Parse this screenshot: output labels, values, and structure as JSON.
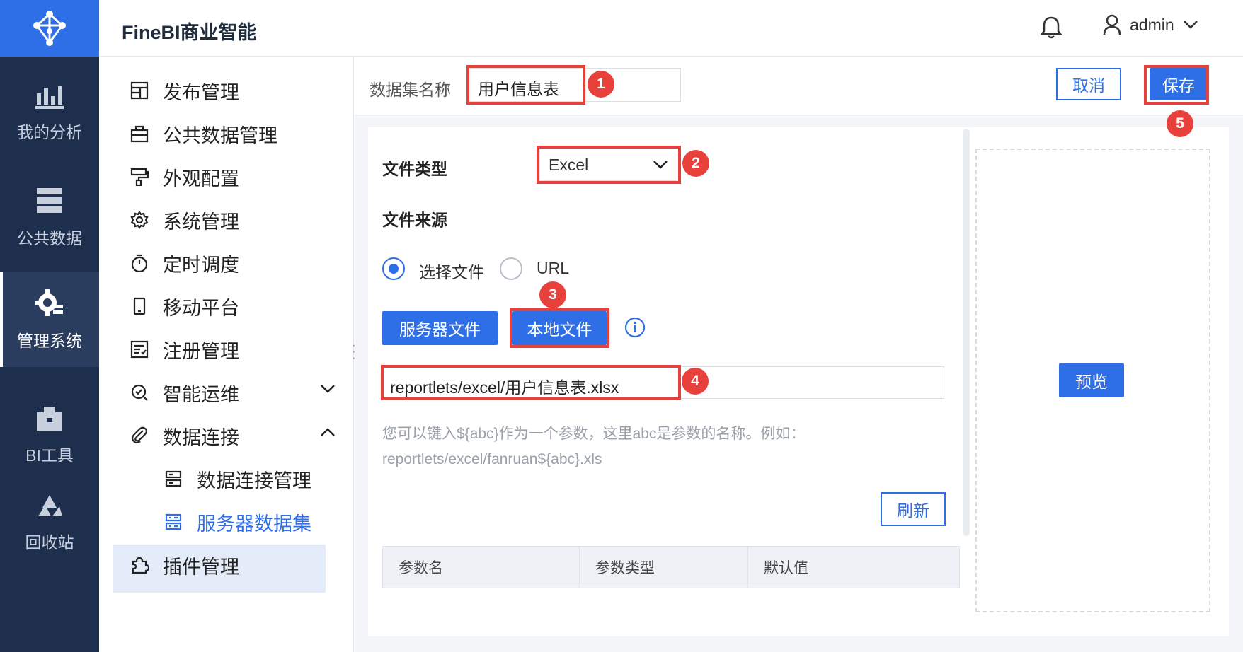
{
  "app": {
    "title": "FineBI商业智能"
  },
  "user": {
    "name": "admin"
  },
  "rail": [
    {
      "label": "我的分析",
      "icon": "analysis-icon"
    },
    {
      "label": "公共数据",
      "icon": "public-data-icon"
    },
    {
      "label": "管理系统",
      "icon": "manage-gear-icon",
      "active": true
    },
    {
      "label": "BI工具",
      "icon": "toolbox-icon"
    },
    {
      "label": "回收站",
      "icon": "recycle-icon"
    }
  ],
  "menu": {
    "items": [
      {
        "label": "发布管理"
      },
      {
        "label": "公共数据管理"
      },
      {
        "label": "外观配置"
      },
      {
        "label": "系统管理"
      },
      {
        "label": "定时调度"
      },
      {
        "label": "移动平台"
      },
      {
        "label": "注册管理"
      },
      {
        "label": "智能运维"
      },
      {
        "label": "数据连接"
      },
      {
        "label": "数据连接管理"
      },
      {
        "label": "服务器数据集"
      },
      {
        "label": "插件管理"
      }
    ]
  },
  "form": {
    "dataset_name_label": "数据集名称",
    "dataset_name_value": "用户信息表",
    "cancel_label": "取消",
    "save_label": "保存",
    "file_type_label": "文件类型",
    "file_type_value": "Excel",
    "file_source_label": "文件来源",
    "radio_choose_file": "选择文件",
    "radio_url": "URL",
    "server_file_button": "服务器文件",
    "local_file_button": "本地文件",
    "path_value": "reportlets/excel/用户信息表.xlsx",
    "hint_line1": "您可以键入${abc}作为一个参数，这里abc是参数的名称。例如：",
    "hint_line2": "reportlets/excel/fanruan${abc}.xls",
    "refresh_label": "刷新",
    "preview_label": "预览",
    "table_headers": [
      "参数名",
      "参数类型",
      "默认值"
    ]
  },
  "annotations": [
    "1",
    "2",
    "3",
    "4",
    "5"
  ],
  "colors": {
    "accent": "#2e6ee6",
    "rail": "#1e2e4d",
    "highlight": "#e8403a"
  }
}
